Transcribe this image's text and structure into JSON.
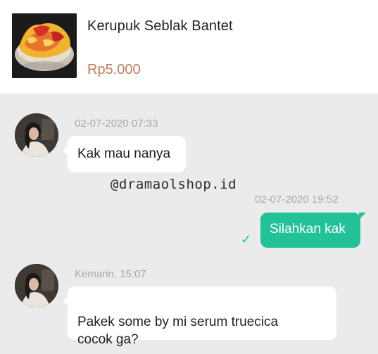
{
  "product": {
    "name": "Kerupuk Seblak Bantet",
    "price": "Rp5.000",
    "thumbnail_icon": "food-bowl-image"
  },
  "watermark": "@dramaolshop.id",
  "messages": [
    {
      "direction": "incoming",
      "timestamp": "02-07-2020 07:33",
      "text": "Kak mau nanya"
    },
    {
      "direction": "outgoing",
      "timestamp": "02-07-2020 19:52",
      "text": "Silahkan kak",
      "status_icon": "check-icon"
    },
    {
      "direction": "incoming",
      "timestamp": "Kemarin, 15:07",
      "text": "Pakek some by mi serum truecica\ncocok ga?"
    }
  ],
  "colors": {
    "outgoing_bubble": "#22c197",
    "price": "#c07c59",
    "background": "#ebebeb"
  }
}
